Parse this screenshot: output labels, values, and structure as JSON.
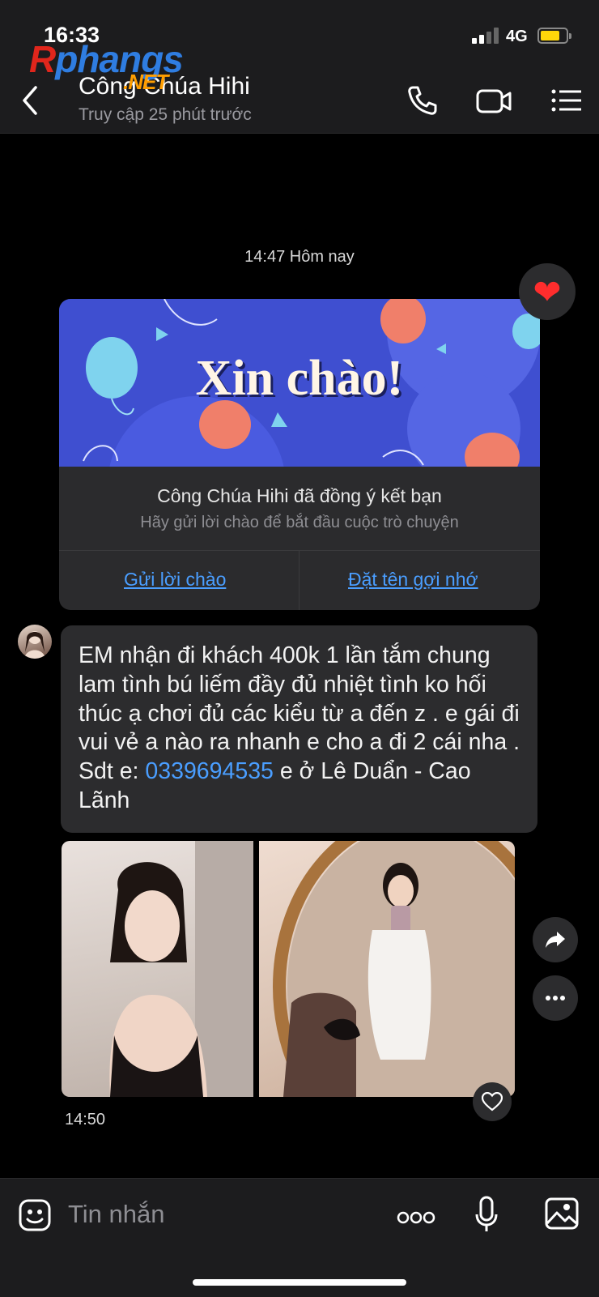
{
  "status_bar": {
    "time": "16:33",
    "network": "4G",
    "battery_level": 0.75
  },
  "header": {
    "title": "Công Chúa Hihi",
    "subtitle": "Truy cập 25 phút trước",
    "watermark_r": "R",
    "watermark_text": "phangs",
    "watermark_net": ".NET"
  },
  "conversation": {
    "date_separator": "14:47 Hôm nay",
    "greeting_card": {
      "banner_text": "Xin chào!",
      "title": "Công Chúa Hihi đã đồng ý kết bạn",
      "subtitle": "Hãy gửi lời chào để bắt đầu cuộc trò chuyện",
      "action_left": "Gửi lời chào",
      "action_right": "Đặt tên gợi nhớ"
    },
    "message": {
      "text_before": "EM nhận đi khách  400k 1 lần tắm chung lam tình bú liếm đầy đủ nhiệt tình ko hối thúc ạ chơi đủ các kiểu từ a đến z . e gái đi vui vẻ a nào ra nhanh e cho a đi 2 cái nha . Sdt e: ",
      "phone": "0339694535",
      "text_after": " e ở Lê Duẩn - Cao Lãnh"
    },
    "photos_time": "14:50"
  },
  "composer": {
    "placeholder": "Tin nhắn"
  },
  "colors": {
    "accent": "#4a9eff",
    "background": "#000000",
    "bubble": "#2c2c2e",
    "header": "#1c1c1e",
    "heart": "#ff2d2d"
  }
}
